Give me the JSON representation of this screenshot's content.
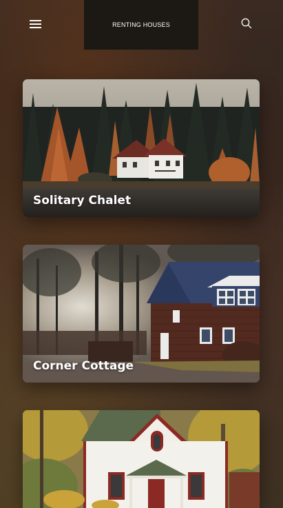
{
  "header": {
    "title": "RENTING HOUSES",
    "menu_icon": "hamburger-menu-icon",
    "search_icon": "search-icon"
  },
  "listings": [
    {
      "label": "Solitary Chalet"
    },
    {
      "label": "Corner Cottage"
    },
    {
      "label": ""
    }
  ],
  "colors": {
    "title_bg": "#1c1814",
    "text": "#ffffff"
  }
}
